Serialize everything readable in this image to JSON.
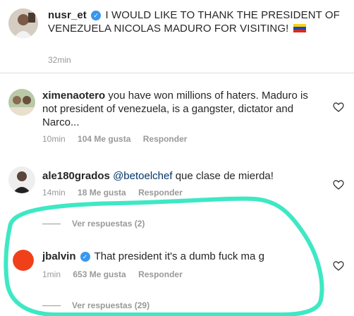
{
  "post": {
    "username": "nusr_et",
    "text": "I WOULD LIKE TO THANK THE PRESIDENT OF VENEZUELA NICOLAS MADURO FOR VISITING!",
    "time": "32min"
  },
  "comments": [
    {
      "username": "ximenaotero",
      "text": "you have won millions of haters. Maduro is not president of venezuela, is a gangster, dictator and Narco...",
      "time": "10min",
      "likes": "104 Me gusta",
      "reply": "Responder"
    },
    {
      "username": "ale180grados",
      "mention": "@betoelchef",
      "text": "que clase de mierda!",
      "time": "14min",
      "likes": "18 Me gusta",
      "reply": "Responder",
      "view_replies": "Ver respuestas (2)"
    },
    {
      "username": "jbalvin",
      "text": "That president it's a dumb fuck ma g",
      "time": "1min",
      "likes": "653 Me gusta",
      "reply": "Responder",
      "view_replies": "Ver respuestas (29)"
    }
  ],
  "colors": {
    "verified": "#3897f0",
    "mention": "#003569",
    "secondary_text": "#999999",
    "highlight_marker": "#3ee8c4"
  },
  "icons": {
    "verified": "verified-badge-icon",
    "like": "heart-outline-icon",
    "flag": "venezuela-flag-icon"
  }
}
